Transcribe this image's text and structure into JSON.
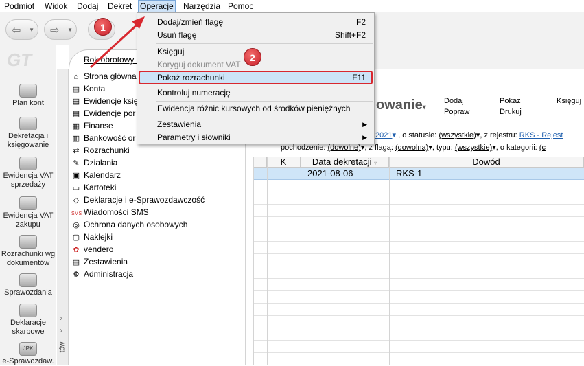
{
  "menubar": [
    "Podmiot",
    "Widok",
    "Dodaj",
    "Dekret",
    "Operacje",
    "Narzędzia",
    "Pomoc"
  ],
  "left_nav": [
    {
      "label": "Plan kont",
      "icon": "plan-kont-icon"
    },
    {
      "label": "Dekretacja i księgowanie",
      "icon": "dekretacja-icon"
    },
    {
      "label": "Ewidencja VAT sprzedaży",
      "icon": "vat-sprzedaz-icon"
    },
    {
      "label": "Ewidencja VAT zakupu",
      "icon": "vat-zakup-icon"
    },
    {
      "label": "Rozrachunki wg dokumentów",
      "icon": "rozrachunki-icon"
    },
    {
      "label": "Sprawozdania",
      "icon": "sprawozdania-icon"
    },
    {
      "label": "Deklaracje skarbowe",
      "icon": "deklaracje-icon"
    },
    {
      "label": "e-Sprawozdaw.",
      "icon": "jpk-icon"
    }
  ],
  "left_nav_jpk": "JPK",
  "side_strip_label": "tów",
  "period_label": "Rok obrotowy -",
  "tree": [
    "Strona główna",
    "Konta",
    "Ewidencje księ",
    "Ewidencje por",
    "Finanse",
    "Bankowość or",
    "Rozrachunki",
    "Działania",
    "Kalendarz",
    "Kartoteki",
    "Deklaracje i e-Sprawozdawczość",
    "Wiadomości SMS",
    "Ochrona danych osobowych",
    "Naklejki",
    "vendero",
    "Zestawienia",
    "Administracja"
  ],
  "content": {
    "title": "owanie",
    "links": [
      "Dodaj",
      "Popraw",
      "Pokaż",
      "Drukuj",
      "Księguj"
    ],
    "filter1": {
      "year": "2021",
      "status_label": ", o statusie:",
      "status": "(wszystkie)",
      "register_label": ", z rejestru:",
      "register": "RKS - Rejest"
    },
    "filter2": {
      "origin_label": "pochodzenie:",
      "origin": "(dowolne)",
      "flag_label": ", z flagą:",
      "flag": "(dowolna)",
      "type_label": ", typu:",
      "type": "(wszystkie)",
      "category_label": ", o kategorii:",
      "category": "(c"
    }
  },
  "grid": {
    "columns": [
      "K",
      "Data dekretacji",
      "Dowód"
    ],
    "rows": [
      {
        "k": "",
        "date": "2021-08-06",
        "doc": "RKS-1"
      }
    ]
  },
  "menu": {
    "items": [
      {
        "label": "Dodaj/zmień flagę",
        "shortcut": "F2"
      },
      {
        "label": "Usuń flagę",
        "shortcut": "Shift+F2"
      },
      {
        "label": "Księguj",
        "shortcut": ""
      },
      {
        "label": "Koryguj dokument VAT",
        "shortcut": ""
      },
      {
        "label": "Pokaż rozrachunki",
        "shortcut": "F11"
      },
      {
        "label": "Kontroluj numerację",
        "shortcut": ""
      },
      {
        "label": "Ewidencja różnic kursowych od środków pieniężnych",
        "shortcut": ""
      },
      {
        "label": "Zestawienia",
        "shortcut": ""
      },
      {
        "label": "Parametry i słowniki",
        "shortcut": ""
      }
    ]
  },
  "badges": [
    "1",
    "2"
  ],
  "colors": {
    "highlight": "#cce4f7",
    "annotation_red": "#d8282f",
    "link_blue": "#1f5fae"
  }
}
